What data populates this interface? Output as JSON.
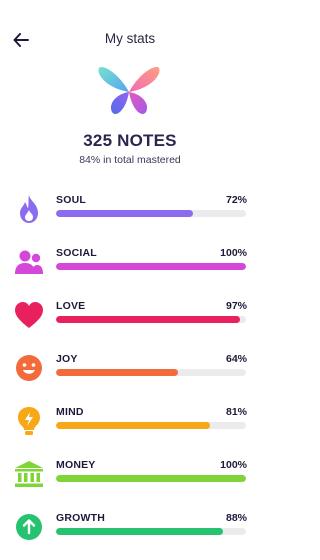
{
  "header": {
    "title": "My stats",
    "back_icon": "arrow-left-icon"
  },
  "summary": {
    "notes": "325 NOTES",
    "mastered": "84% in total mastered"
  },
  "stats": [
    {
      "label": "SOUL",
      "percent_text": "72%",
      "value": 0.72,
      "color": "#8b6cf0",
      "icon": "flame-icon"
    },
    {
      "label": "SOCIAL",
      "percent_text": "100%",
      "value": 1.0,
      "color": "#d447d8",
      "icon": "people-icon"
    },
    {
      "label": "LOVE",
      "percent_text": "97%",
      "value": 0.97,
      "color": "#e8205e",
      "icon": "heart-icon"
    },
    {
      "label": "JOY",
      "percent_text": "64%",
      "value": 0.64,
      "color": "#f36b3a",
      "icon": "smiley-icon"
    },
    {
      "label": "MIND",
      "percent_text": "81%",
      "value": 0.81,
      "color": "#f6a816",
      "icon": "lightbulb-icon"
    },
    {
      "label": "MONEY",
      "percent_text": "100%",
      "value": 1.0,
      "color": "#7fd537",
      "icon": "bank-icon"
    },
    {
      "label": "GROWTH",
      "percent_text": "88%",
      "value": 0.88,
      "color": "#27c26f",
      "icon": "arrow-up-circle-icon"
    }
  ]
}
